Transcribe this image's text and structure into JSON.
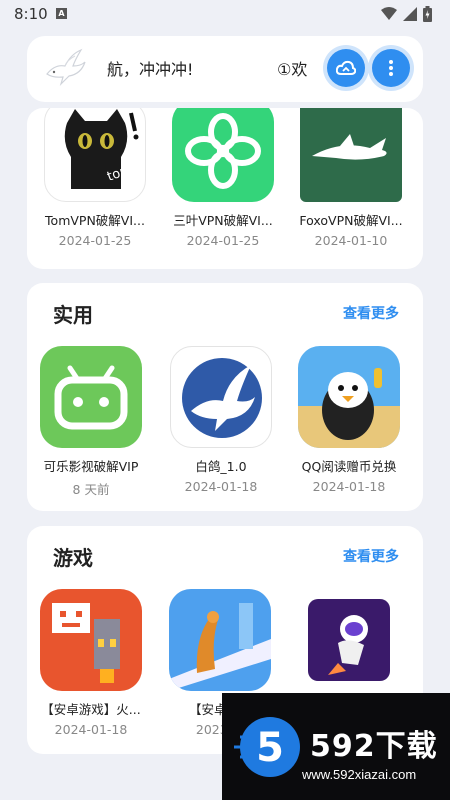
{
  "status_bar": {
    "time": "8:10",
    "notif_letter": "A"
  },
  "header": {
    "marquee_left": "航，冲冲冲!",
    "marquee_right": "①欢"
  },
  "sections": [
    {
      "apps": [
        {
          "name": "TomVPN破解VI...",
          "date": "2024-01-25",
          "icon": "black-cat-tom-icon"
        },
        {
          "name": "三叶VPN破解VI...",
          "date": "2024-01-25",
          "icon": "green-clover-icon"
        },
        {
          "name": "FoxoVPN破解VI...",
          "date": "2024-01-10",
          "icon": "white-fox-icon"
        }
      ]
    },
    {
      "title": "实用",
      "more": "查看更多",
      "apps": [
        {
          "name": "可乐影视破解VIP",
          "date": "8 天前",
          "icon": "android-robot-icon"
        },
        {
          "name": "白鸽_1.0",
          "date": "2024-01-18",
          "icon": "white-dove-icon"
        },
        {
          "name": "QQ阅读赠币兑换",
          "date": "2024-01-18",
          "icon": "penguin-mascot-icon"
        }
      ]
    },
    {
      "title": "游戏",
      "more": "查看更多",
      "apps": [
        {
          "name": "【安卓游戏】火...",
          "date": "2024-01-18",
          "icon": "pixel-rocket-icon"
        },
        {
          "name": "【安卓游...",
          "date": "2023-...",
          "icon": "bird-runner-icon"
        },
        {
          "name": "",
          "date": "",
          "icon": "astronaut-icon"
        }
      ]
    }
  ],
  "watermark": {
    "brand": "592下载",
    "url": "www.592xiazai.com",
    "logo_digit": "5"
  }
}
